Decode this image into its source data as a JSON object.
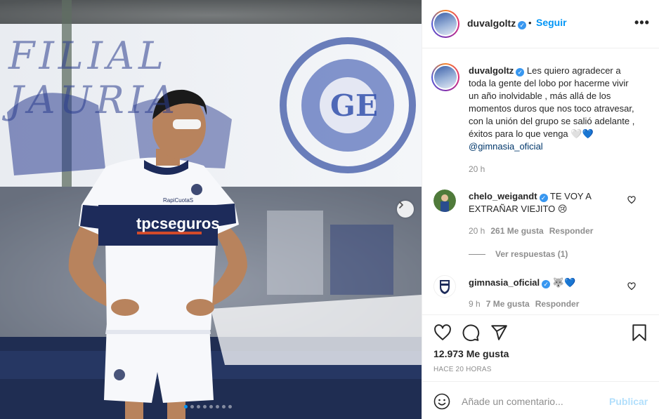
{
  "photo": {
    "banner_text": "FILIAL JAURIA",
    "shirt_sponsor": "tpcseguros",
    "shirt_brand": "RapiCuotaS",
    "carousel_dots": 8,
    "active_dot": 0
  },
  "header": {
    "username": "duvalgoltz",
    "dot": "•",
    "follow_label": "Seguir",
    "more_label": "•••"
  },
  "caption": {
    "username": "duvalgoltz",
    "text": "Les quiero agradecer a toda la gente del lobo por hacerme vivir un año inolvidable , más allá de los momentos duros que nos toco atravesar, con la unión del grupo se salió adelante , éxitos para lo que venga",
    "emojis": "🤍💙",
    "mention": "@gimnasia_oficial",
    "time": "20 h"
  },
  "comments": [
    {
      "username": "chelo_weigandt",
      "text": "TE VOY A EXTRAÑAR VIEJITO",
      "emoji": "😢",
      "time": "20 h",
      "likes": "261 Me gusta",
      "reply_label": "Responder",
      "view_replies": "Ver respuestas (1)"
    },
    {
      "username": "gimnasia_oficial",
      "text": "",
      "emoji": "🐺💙",
      "time": "9 h",
      "likes": "7 Me gusta",
      "reply_label": "Responder"
    }
  ],
  "actions": {
    "likes_count": "12.973 Me gusta",
    "timestamp": "HACE 20 HORAS"
  },
  "add_comment": {
    "placeholder": "Añade un comentario...",
    "post_label": "Publicar"
  },
  "colors": {
    "accent": "#0095f6",
    "post_disabled": "#b2dffc",
    "verified": "#3897f0",
    "shirt_navy": "#1d2b5a"
  }
}
